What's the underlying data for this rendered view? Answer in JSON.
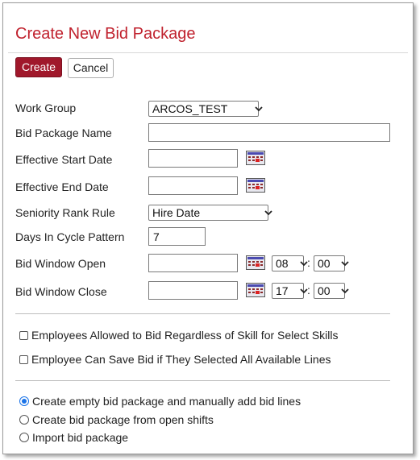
{
  "dialog": {
    "title": "Create New Bid Package"
  },
  "toolbar": {
    "create_label": "Create",
    "cancel_label": "Cancel"
  },
  "form": {
    "work_group": {
      "label": "Work Group",
      "value": "ARCOS_TEST"
    },
    "bid_package_name": {
      "label": "Bid Package Name",
      "value": ""
    },
    "effective_start_date": {
      "label": "Effective Start Date",
      "value": ""
    },
    "effective_end_date": {
      "label": "Effective End Date",
      "value": ""
    },
    "seniority_rank_rule": {
      "label": "Seniority Rank Rule",
      "value": "Hire Date"
    },
    "days_in_cycle_pattern": {
      "label": "Days In Cycle Pattern",
      "value": "7"
    },
    "bid_window_open": {
      "label": "Bid Window Open",
      "date": "",
      "hour": "08",
      "minute": "00"
    },
    "bid_window_close": {
      "label": "Bid Window Close",
      "date": "",
      "hour": "17",
      "minute": "00"
    },
    "time_separator": ":"
  },
  "options": {
    "allow_bid_regardless_of_skill": {
      "label": "Employees Allowed to Bid Regardless of Skill for Select Skills",
      "checked": false
    },
    "save_bid_if_all_lines": {
      "label": "Employee Can Save Bid if They Selected All Available Lines",
      "checked": false
    }
  },
  "creation_mode": {
    "selected": "empty",
    "choices": [
      {
        "id": "empty",
        "label": "Create empty bid package and manually add bid lines"
      },
      {
        "id": "open_shifts",
        "label": "Create bid package from open shifts"
      },
      {
        "id": "import",
        "label": "Import bid package"
      }
    ]
  },
  "colors": {
    "title": "#c0222e",
    "primary_button": "#a0182b",
    "radio_accent": "#1a73e8"
  },
  "icons": {
    "calendar": "calendar-icon",
    "dropdown": "chevron-down-icon"
  }
}
